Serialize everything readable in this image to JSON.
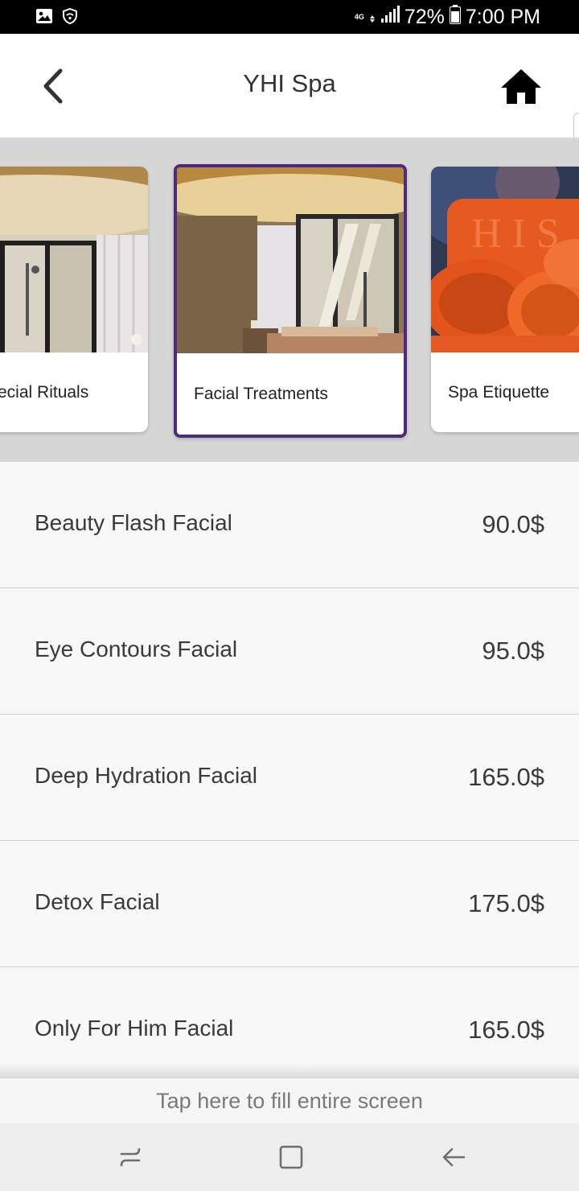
{
  "status_bar": {
    "network_type": "4G",
    "battery": "72%",
    "time": "7:00 PM",
    "icons": [
      "image-icon",
      "wifi-shield-icon",
      "data-arrows-icon",
      "signal-icon",
      "battery-icon"
    ]
  },
  "app_bar": {
    "title": "YHI Spa",
    "icons": [
      "back-chevron-icon",
      "home-icon"
    ]
  },
  "categories": [
    {
      "label": "ecial Rituals",
      "selected": false,
      "image": "spa-shower-room-photo"
    },
    {
      "label": "Facial Treatments",
      "selected": true,
      "image": "spa-treatment-room-photo"
    },
    {
      "label": "Spa Etiquette",
      "selected": false,
      "image": "orange-towels-photo"
    }
  ],
  "services": [
    {
      "name": "Beauty Flash Facial",
      "price": "90.0$"
    },
    {
      "name": "Eye Contours Facial",
      "price": "95.0$"
    },
    {
      "name": "Deep Hydration Facial",
      "price": "165.0$"
    },
    {
      "name": "Detox Facial",
      "price": "175.0$"
    },
    {
      "name": "Only For Him Facial",
      "price": "165.0$"
    }
  ],
  "fill_banner": {
    "label": "Tap here to fill entire screen"
  },
  "nav_bar": {
    "icons": [
      "recent-apps-icon",
      "home-square-icon",
      "back-arrow-icon"
    ]
  },
  "colors": {
    "selected_border": "#4e2a7a",
    "strip_background": "#d6d6d6",
    "list_background": "#f8f8f8"
  }
}
